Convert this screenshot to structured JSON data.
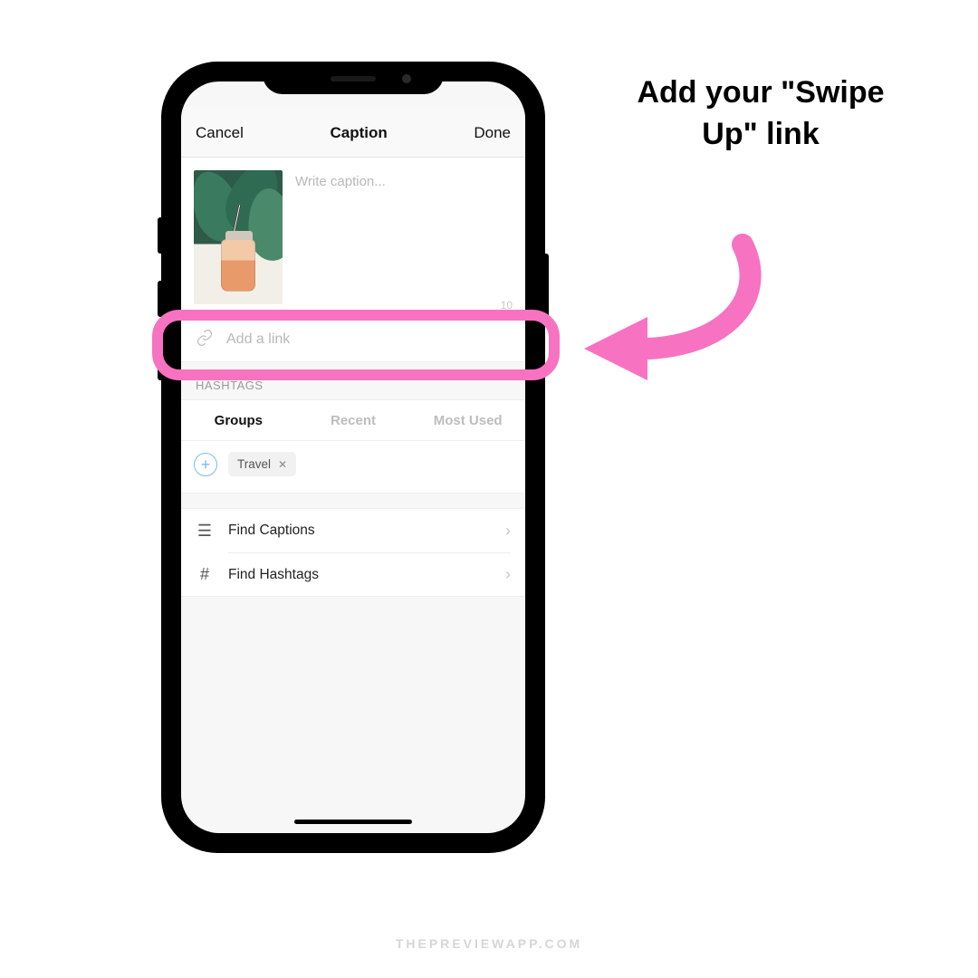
{
  "callout": "Add your \"Swipe Up\" link",
  "watermark": "THEPREVIEWAPP.COM",
  "colors": {
    "accent_pink": "#f772c1",
    "icon_blue": "#7bbce8"
  },
  "nav": {
    "cancel": "Cancel",
    "title": "Caption",
    "done": "Done"
  },
  "caption": {
    "placeholder": "Write caption...",
    "char_count": "10"
  },
  "link_row": {
    "placeholder": "Add a link"
  },
  "hashtags": {
    "header": "HASHTAGS",
    "tabs": {
      "groups": "Groups",
      "recent": "Recent",
      "most_used": "Most Used"
    },
    "chip": "Travel"
  },
  "list": {
    "find_captions": "Find Captions",
    "find_hashtags": "Find Hashtags"
  }
}
